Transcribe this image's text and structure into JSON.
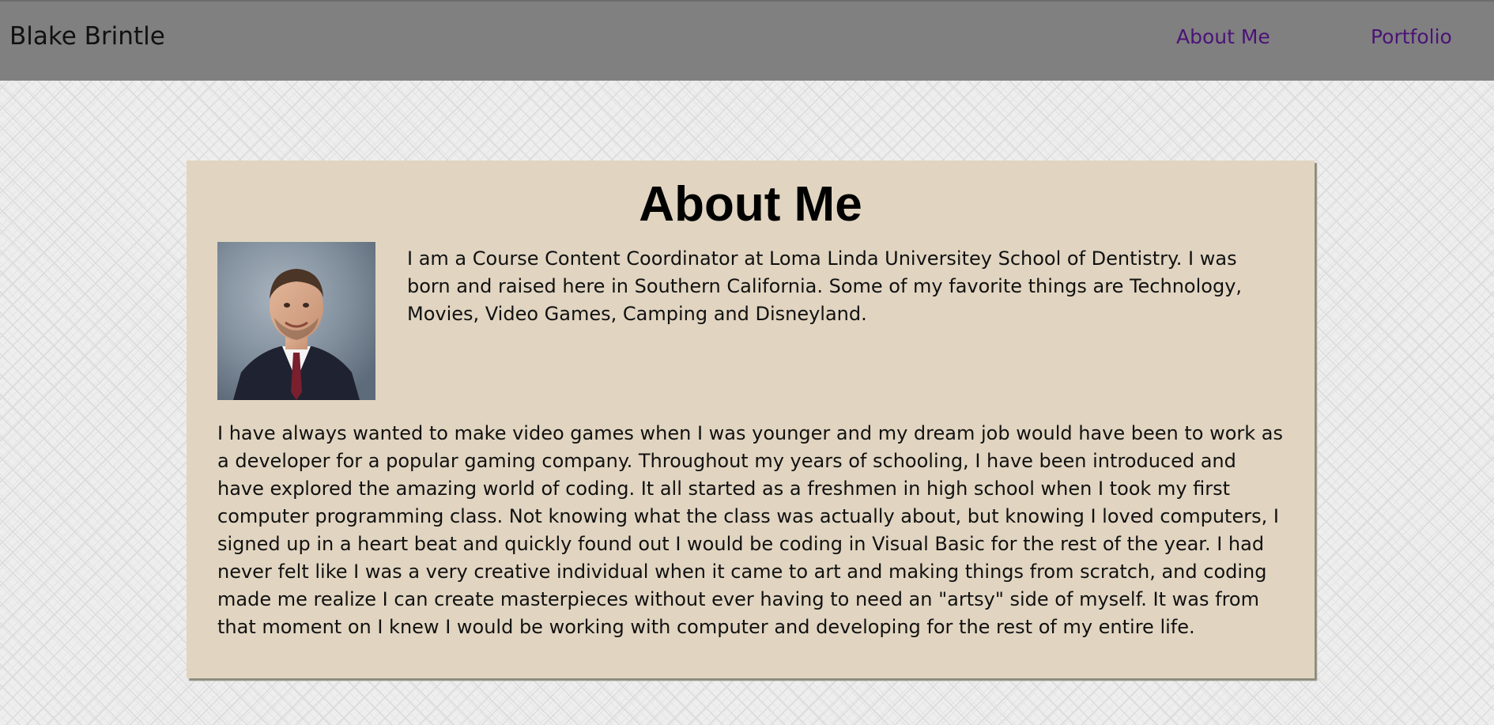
{
  "navbar": {
    "brand": "Blake Brintle",
    "links": [
      {
        "label": "About Me"
      },
      {
        "label": "Portfolio"
      }
    ],
    "link_color": "#4b1278",
    "background": "#808080"
  },
  "about": {
    "title": "About Me",
    "portrait_alt": "Portrait of Blake Brintle",
    "intro": "I am a Course Content Coordinator at Loma Linda Universitey School of Dentistry. I was born and raised here in Southern California. Some of my favorite things are Technology, Movies, Video Games, Camping and Disneyland.",
    "story": "I have always wanted to make video games when I was younger and my dream job would have been to work as a developer for a popular gaming company. Throughout my years of schooling, I have been introduced and have explored the amazing world of coding. It all started as a freshmen in high school when I took my first computer programming class. Not knowing what the class was actually about, but knowing I loved computers, I signed up in a heart beat and quickly found out I would be coding in Visual Basic for the rest of the year. I had never felt like I was a very creative individual when it came to art and making things from scratch, and coding made me realize I can create masterpieces without ever having to need an \"artsy\" side of myself. It was from that moment on I knew I would be working with computer and developing for the rest of my entire life.",
    "card_background": "#e1d5c1"
  }
}
